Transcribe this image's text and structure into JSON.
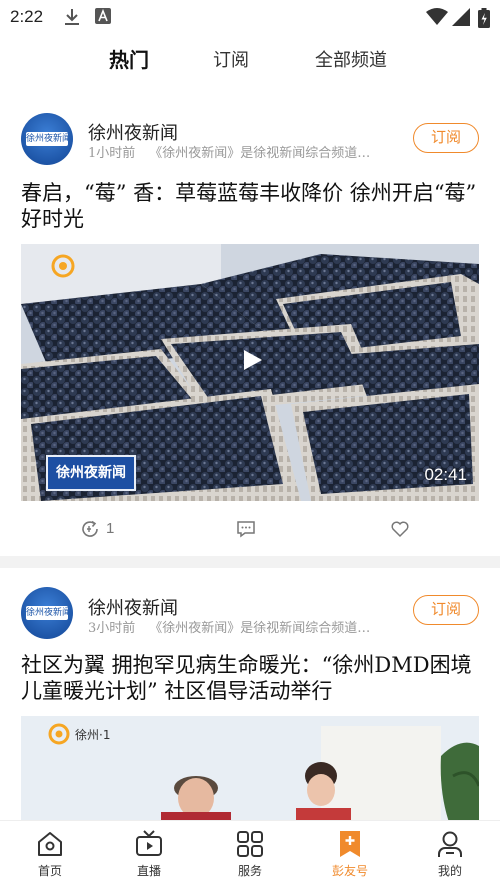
{
  "status_bar": {
    "time": "2:22"
  },
  "top_tabs": [
    {
      "label": "热门",
      "active": true
    },
    {
      "label": "订阅",
      "active": false
    },
    {
      "label": "全部频道",
      "active": false
    }
  ],
  "feed": [
    {
      "channel": "徐州夜新闻",
      "time": "1小时前",
      "description": "《徐州夜新闻》是徐视新闻综合频道…",
      "subscribe_label": "订阅",
      "headline": "春启，“莓” 香：草莓蓝莓丰收降价 徐州开启“莓” 好时光",
      "video_duration": "02:41",
      "video_logo_text": "徐州夜新闻",
      "share_count": "1"
    },
    {
      "channel": "徐州夜新闻",
      "time": "3小时前",
      "description": "《徐州夜新闻》是徐视新闻综合频道…",
      "subscribe_label": "订阅",
      "headline": "社区为翼 拥抱罕见病生命暖光：“徐州DMD困境儿童暖光计划” 社区倡导活动举行",
      "video_logo_text": "徐州·1"
    }
  ],
  "avatar_logo_text": "徐州夜新闻",
  "bottom_nav": [
    {
      "label": "首页",
      "icon": "home-icon",
      "active": false
    },
    {
      "label": "直播",
      "icon": "tv-icon",
      "active": false
    },
    {
      "label": "服务",
      "icon": "grid-icon",
      "active": false
    },
    {
      "label": "彭友号",
      "icon": "bookmark-plus-icon",
      "active": true
    },
    {
      "label": "我的",
      "icon": "user-icon",
      "active": false
    }
  ],
  "colors": {
    "accent": "#f08a2c",
    "avatar_blue": "#1e56a8"
  }
}
